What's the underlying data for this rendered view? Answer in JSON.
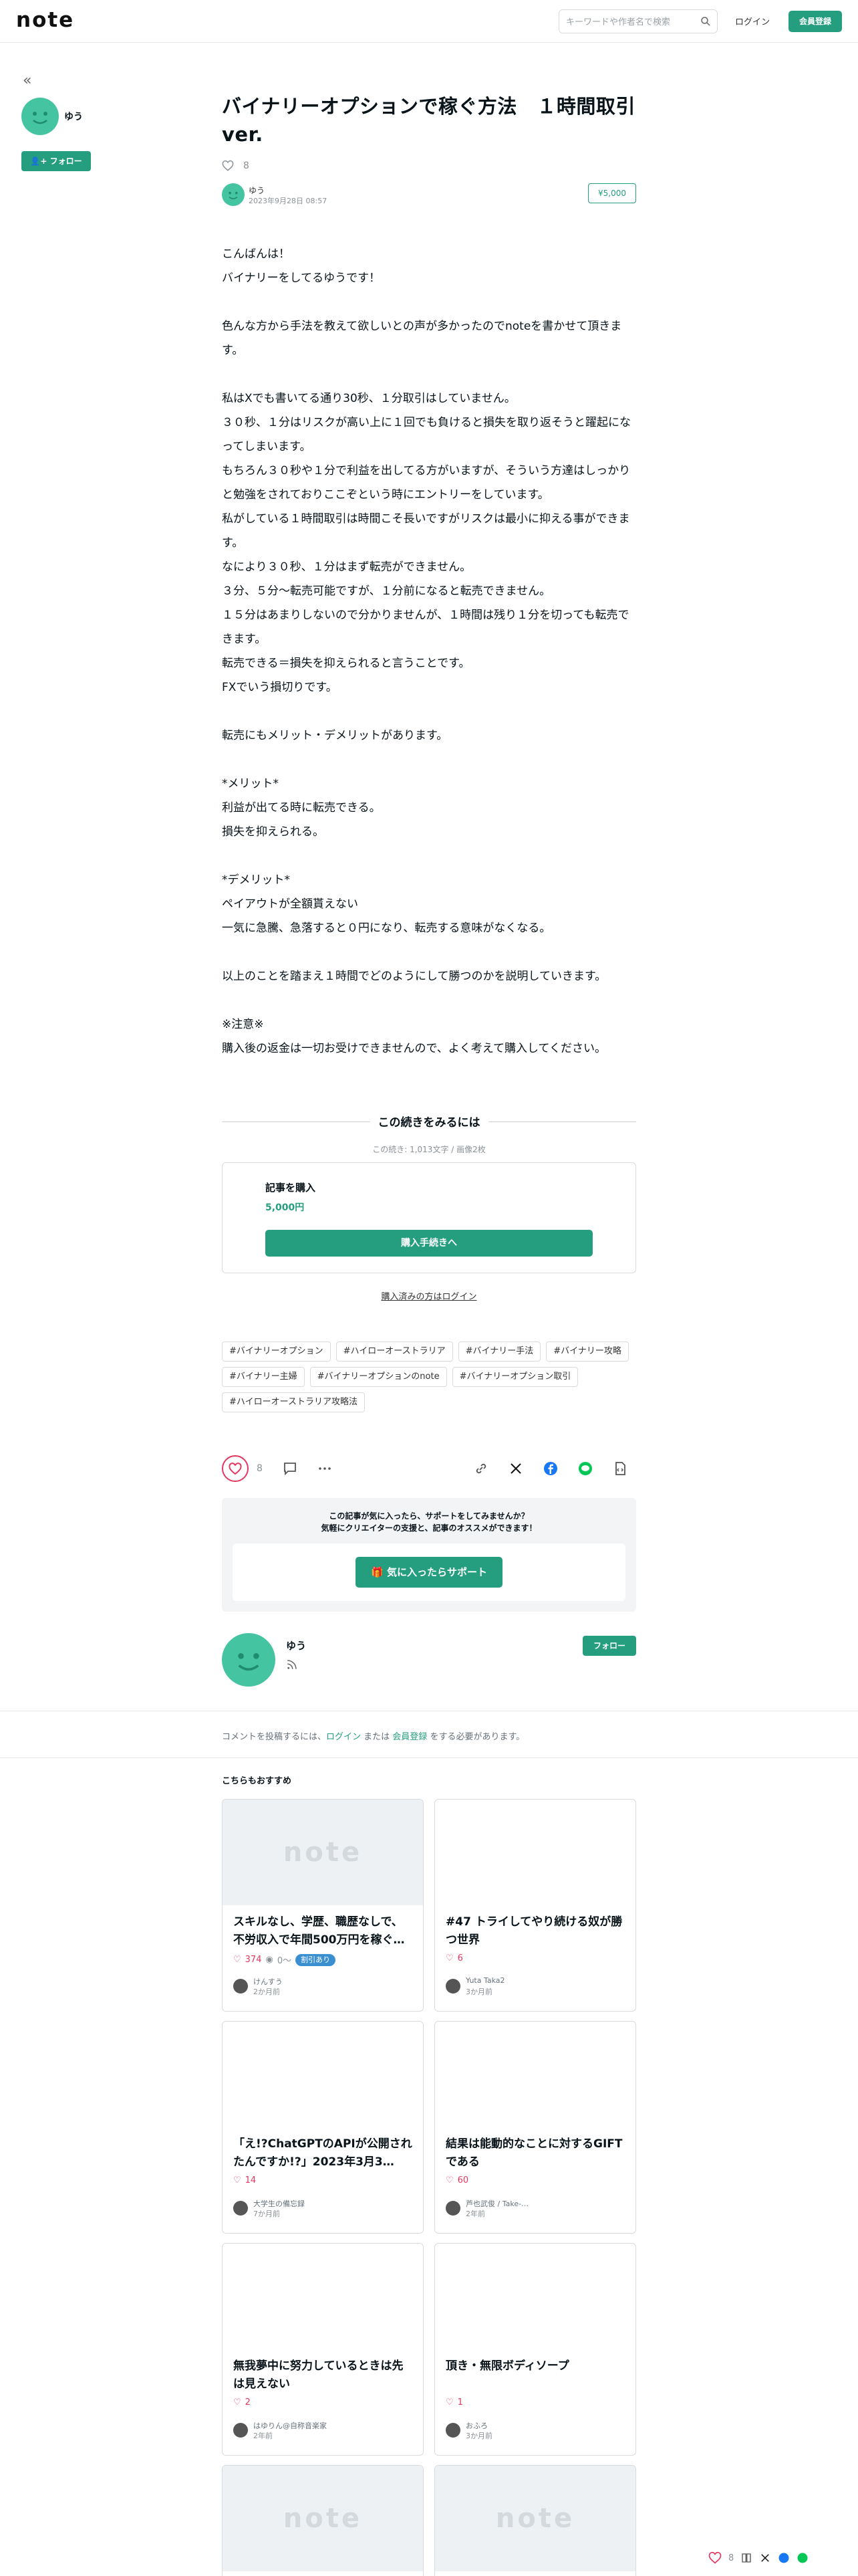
{
  "header": {
    "logo": "note",
    "search_placeholder": "キーワードや作者名で検索",
    "login": "ログイン",
    "signup": "会員登録"
  },
  "sidebar": {
    "author_name": "ゆう",
    "follow_label": "フォロー"
  },
  "article": {
    "title": "バイナリーオプションで稼ぐ方法　１時間取引ver.",
    "like_count": "8",
    "author_name": "ゆう",
    "date": "2023年9月28日 08:57",
    "price_badge": "¥5,000",
    "paragraphs": [
      "こんばんは！",
      "バイナリーをしてるゆうです！",
      "",
      "色んな方から手法を教えて欲しいとの声が多かったのでnoteを書かせて頂きます。",
      "",
      "私はXでも書いてる通り30秒、１分取引はしていません。",
      "３０秒、１分はリスクが高い上に１回でも負けると損失を取り返そうと躍起になってしまいます。",
      "もちろん３０秒や１分で利益を出してる方がいますが、そういう方達はしっかりと勉強をされておりここぞという時にエントリーをしています。",
      "私がしている１時間取引は時間こそ長いですがリスクは最小に抑える事ができます。",
      "なにより３０秒、１分はまず転売ができません。",
      "３分、５分〜転売可能ですが、１分前になると転売できません。",
      "１５分はあまりしないので分かりませんが、１時間は残り１分を切っても転売できます。",
      "転売できる＝損失を抑えられると言うことです。",
      "FXでいう損切りです。",
      "",
      "転売にもメリット・デメリットがあります。",
      "",
      "*メリット*",
      "利益が出てる時に転売できる。",
      "損失を抑えられる。",
      "",
      "*デメリット*",
      "ペイアウトが全額貰えない",
      "一気に急騰、急落すると０円になり、転売する意味がなくなる。",
      "",
      "以上のことを踏まえ１時間でどのようにして勝つのかを説明していきます。",
      "",
      "※注意※",
      "購入後の返金は一切お受けできませんので、よく考えて購入してください。"
    ]
  },
  "paywall": {
    "title": "この続きをみるには",
    "meta": "この続き: 1,013文字 / 画像2枚",
    "buy_title": "記事を購入",
    "buy_price": "5,000円",
    "buy_button": "購入手続きへ",
    "bought_login": "購入済みの方はログイン"
  },
  "tags": [
    "#バイナリーオプション",
    "#ハイローオーストラリア",
    "#バイナリー手法",
    "#バイナリー攻略",
    "#バイナリー主婦",
    "#バイナリーオプションのnote",
    "#バイナリーオプション取引",
    "#ハイローオーストラリア攻略法"
  ],
  "actions": {
    "like_count": "8"
  },
  "support": {
    "line1": "この記事が気に入ったら、サポートをしてみませんか？",
    "line2": "気軽にクリエイターの支援と、記事のオススメができます！",
    "button": "気に入ったらサポート"
  },
  "author_card": {
    "name": "ゆう",
    "follow_label": "フォロー"
  },
  "comment": {
    "prefix": "コメントを投稿するには、",
    "login": "ログイン",
    "middle": " または ",
    "signup": "会員登録",
    "suffix": " をする必要があります。"
  },
  "recommend": {
    "title": "こちらもおすすめ",
    "cards": [
      {
        "title": "スキルなし、学歴、職歴なしで、不労収入で年間500万円を稼ぐ…",
        "likes": "374",
        "views": "0〜",
        "badge": "割引あり",
        "author": "けんすう",
        "time": "2か月前",
        "thumb_logo": "note"
      },
      {
        "title": "#47 トライしてやり続ける奴が勝つ世界",
        "likes": "6",
        "author": "Yuta Taka2",
        "time": "3か月前"
      },
      {
        "title": "「え!?ChatGPTのAPIが公開されたんですか!?」2023年3月3…",
        "likes": "14",
        "author": "大学生の備忘録",
        "time": "7か月前"
      },
      {
        "title": "結果は能動的なことに対するGIFTである",
        "likes": "60",
        "author": "芦也武俊 / Take-…",
        "time": "2年前"
      },
      {
        "title": "無我夢中に努力しているときは先は見えない",
        "likes": "2",
        "author": "はゆりん@自称音楽家",
        "time": "2年前"
      },
      {
        "title": "頂き・無限ボディソープ",
        "likes": "1",
        "author": "おふろ",
        "time": "3か月前"
      },
      {
        "thumb_logo": "note"
      },
      {
        "thumb_logo": "note"
      }
    ]
  },
  "float": {
    "like_count": "8"
  },
  "colors": {
    "accent": "#249e7e",
    "like": "#e5375f",
    "avatar": "#44c4a1"
  }
}
